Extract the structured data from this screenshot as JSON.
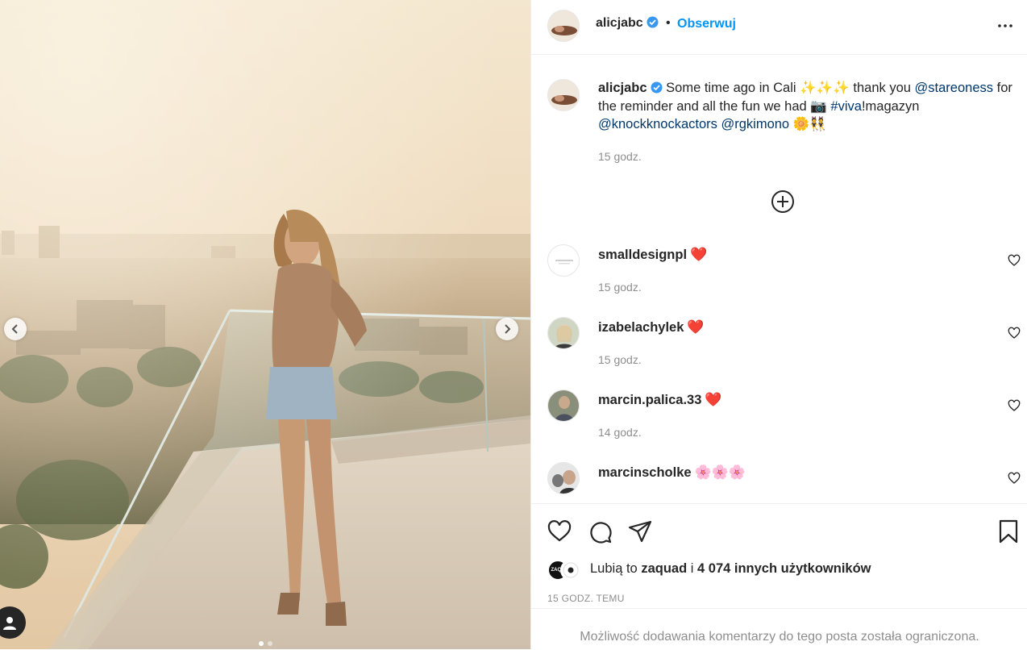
{
  "post": {
    "username": "alicjabc",
    "separator": "•",
    "follow_label": "Obserwuj",
    "more_label": "Więcej opcji"
  },
  "caption": {
    "username": "alicjabc",
    "text_1": "Some time ago in Cali",
    "emoji_1": "✨✨✨",
    "text_2": "thank you",
    "mention_1": "@stareoness",
    "text_3": "for the reminder and all the fun we had",
    "emoji_2": "📷",
    "hashtag": "#viva",
    "text_4": "!magazyn",
    "mention_2": "@knockknockactors",
    "mention_3": "@rgkimono",
    "emoji_3": "🌼👯",
    "time": "15 godz."
  },
  "comments": [
    {
      "username": "smalldesignpl",
      "emoji": "❤️",
      "time": "15 godz."
    },
    {
      "username": "izabelachylek",
      "emoji": "❤️",
      "time": "15 godz."
    },
    {
      "username": "marcin.palica.33",
      "emoji": "❤️",
      "time": "14 godz."
    },
    {
      "username": "marcinscholke",
      "emoji": "🌸🌸🌸",
      "time": ""
    }
  ],
  "likes": {
    "prefix": "Lubią to",
    "user": "zaquad",
    "joiner": "i",
    "count_text": "4 074 innych użytkowników",
    "avatar_1_text": "ZAQU"
  },
  "time_ago": "15 GODZ. TEMU",
  "comments_restricted": "Możliwość dodawania komentarzy do tego posta została ograniczona.",
  "carousel": {
    "slide_count": 2,
    "active_index": 0
  },
  "colors": {
    "accent": "#0095f6",
    "link": "#00376b",
    "muted": "#8e8e8e",
    "text": "#262626"
  }
}
